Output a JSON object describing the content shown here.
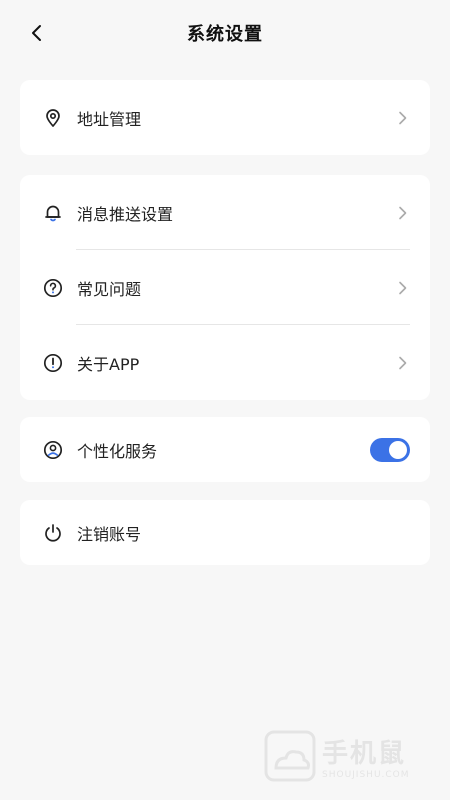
{
  "header": {
    "title": "系统设置"
  },
  "groups": {
    "address": {
      "label": "地址管理"
    },
    "notify": {
      "label": "消息推送设置"
    },
    "faq": {
      "label": "常见问题"
    },
    "about": {
      "label": "关于APP"
    },
    "personalized": {
      "label": "个性化服务",
      "enabled": true
    },
    "cancel": {
      "label": "注销账号"
    }
  },
  "colors": {
    "accent": "#3b72e6",
    "background": "#f7f7f7",
    "card": "#ffffff"
  },
  "icons": {
    "back": "chevron-left-icon",
    "address": "location-pin-icon",
    "notify": "bell-icon",
    "faq": "question-circle-icon",
    "about": "exclamation-circle-icon",
    "personalized": "user-circle-icon",
    "cancel": "power-icon",
    "chevron": "chevron-right-icon"
  },
  "watermark": {
    "cn": "手机鼠",
    "en": "SHOUJISHU.COM"
  }
}
